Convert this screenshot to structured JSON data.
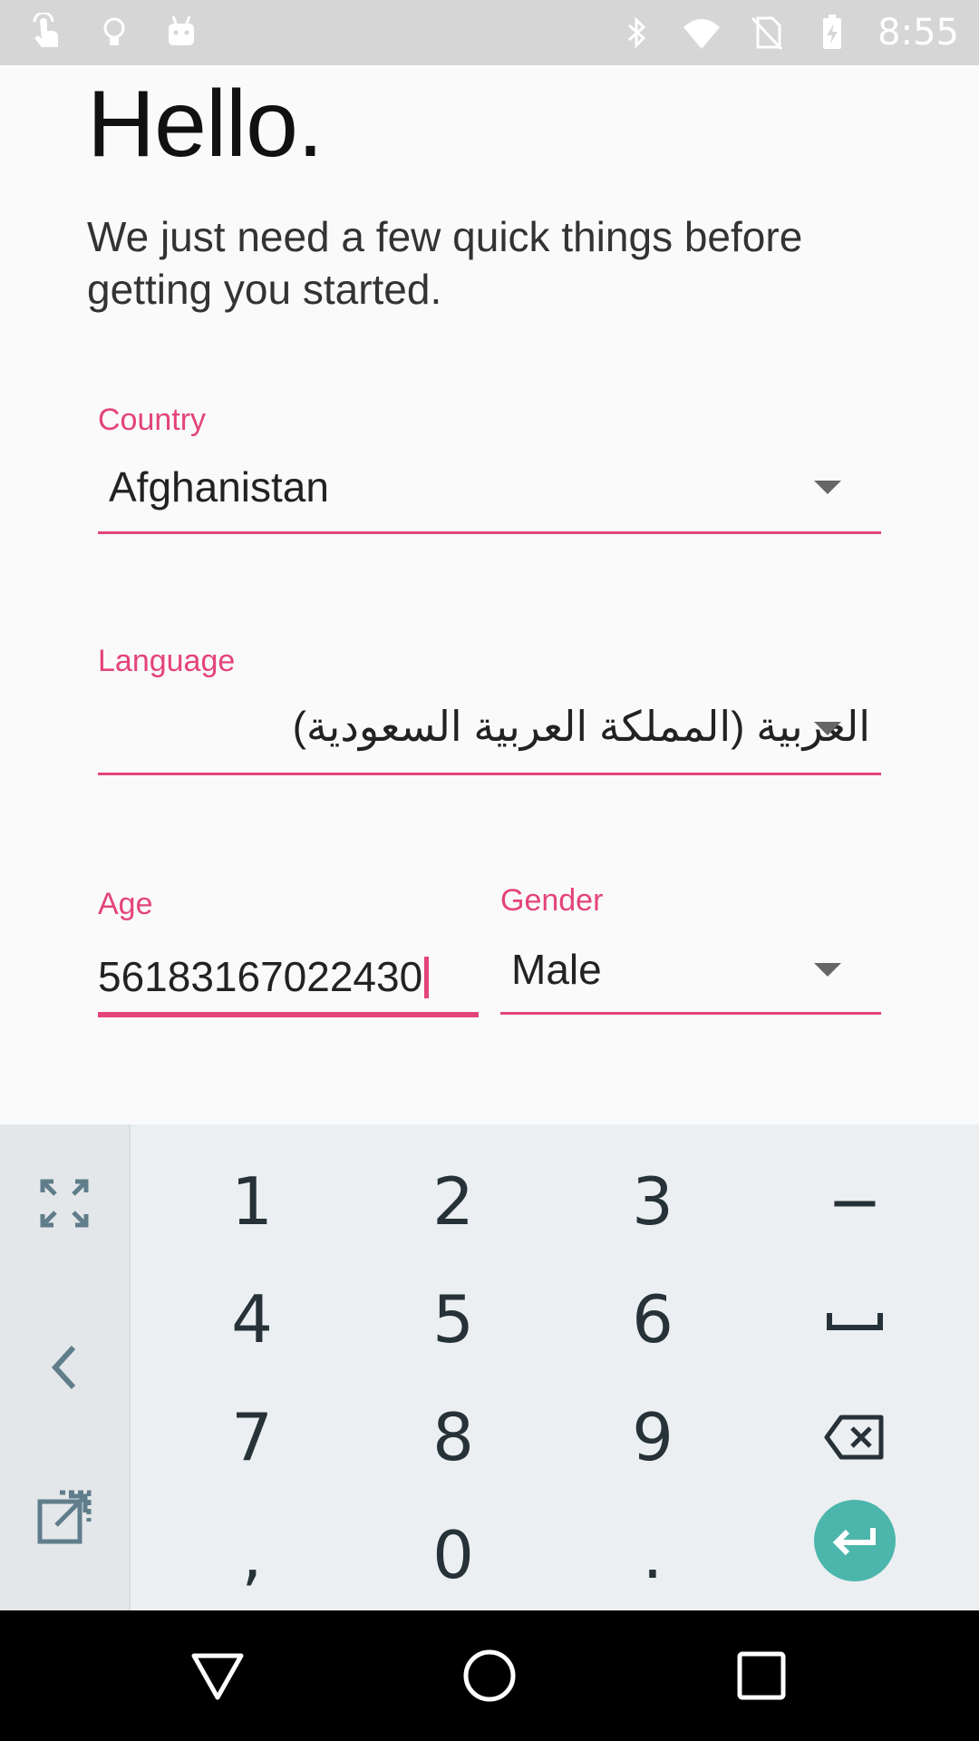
{
  "status_bar": {
    "time": "8:55",
    "left_icons": [
      "touch-icon",
      "lightbulb-icon",
      "android-icon"
    ],
    "right_icons": [
      "bluetooth-icon",
      "wifi-icon",
      "no-sim-icon",
      "battery-charging-icon"
    ]
  },
  "header": {
    "title": "Hello.",
    "subtitle": "We just need a few quick things before getting you started."
  },
  "form": {
    "country": {
      "label": "Country",
      "value": "Afghanistan"
    },
    "language": {
      "label": "Language",
      "value": "العربية (المملكة العربية السعودية)"
    },
    "age": {
      "label": "Age",
      "value": "56183167022430"
    },
    "gender": {
      "label": "Gender",
      "value": "Male"
    }
  },
  "keyboard": {
    "keys": [
      [
        "1",
        "2",
        "3",
        "−"
      ],
      [
        "4",
        "5",
        "6",
        "␣"
      ],
      [
        "7",
        "8",
        "9",
        "backspace"
      ],
      [
        ",",
        "0",
        ".",
        "enter"
      ]
    ],
    "side_icons": [
      "fullscreen-icon",
      "back-chevron-icon",
      "external-link-icon"
    ]
  },
  "navigation": [
    "back-icon",
    "home-icon",
    "recents-icon"
  ],
  "colors": {
    "accent": "#e44479",
    "enter_button": "#4db6ac",
    "status_bar": "#d6d6d6",
    "keyboard_bg": "#eceff1"
  }
}
